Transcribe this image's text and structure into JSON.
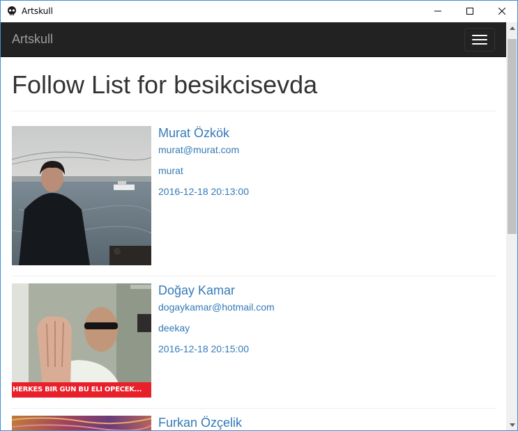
{
  "window": {
    "title": "Artskull"
  },
  "navbar": {
    "brand": "Artskull",
    "menu_icon": "hamburger-icon"
  },
  "page": {
    "title": "Follow List for besikcisevda"
  },
  "follows": [
    {
      "name": "Murat Özkök",
      "email": "murat@murat.com",
      "username": "murat",
      "date": "2016-12-18 20:13:00"
    },
    {
      "name": "Doğay Kamar",
      "email": "dogaykamar@hotmail.com",
      "username": "deekay",
      "date": "2016-12-18 20:15:00",
      "photo_caption": "HERKES BİR GÜN BU ELİ ÖPECEK..."
    },
    {
      "name": "Furkan Özçelik"
    }
  ],
  "colors": {
    "navbar_bg": "#222222",
    "brand": "#9d9d9d",
    "link": "#337ab7",
    "caption_bar": "#e8202a"
  }
}
